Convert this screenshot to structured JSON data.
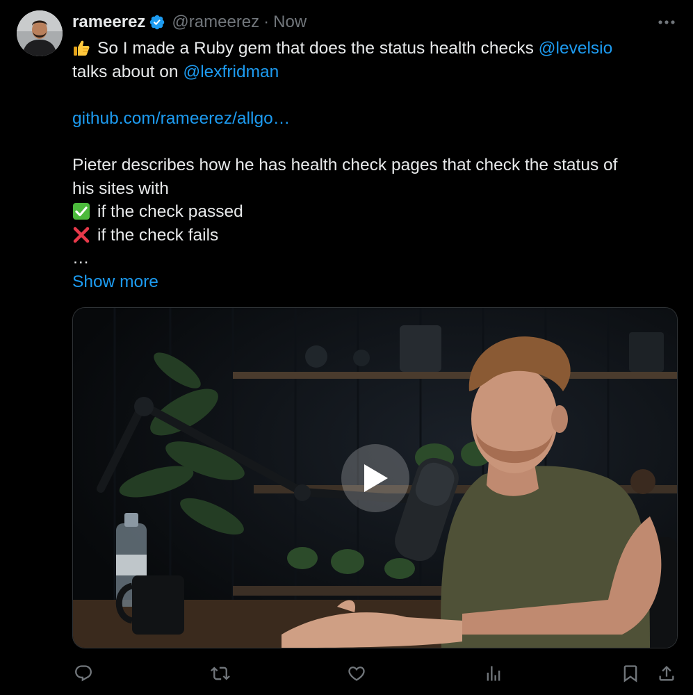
{
  "user": {
    "display_name": "rameerez",
    "handle": "@rameerez",
    "separator": "·",
    "time": "Now"
  },
  "tweet": {
    "line1_text": "So I made a Ruby gem that does the status health checks ",
    "line1_mention": "@levelsio",
    "line2_text": "talks about on ",
    "line2_mention": "@lexfridman",
    "link": "github.com/rameerez/allgo…",
    "para_line1": "Pieter describes how he has health check pages that check the status of",
    "para_line2": "his sites with",
    "pass_line": "if the check passed",
    "fail_line": "if the check fails",
    "ellipsis": "…",
    "show_more": "Show more"
  },
  "icons": {
    "thumbs_up": "thumbs-up-emoji",
    "check": "check-mark-emoji",
    "cross": "cross-mark-emoji",
    "verified": "verified-badge-icon"
  },
  "colors": {
    "background": "#000000",
    "text": "#e7e9ea",
    "muted": "#71767b",
    "link": "#1d9bf0"
  }
}
